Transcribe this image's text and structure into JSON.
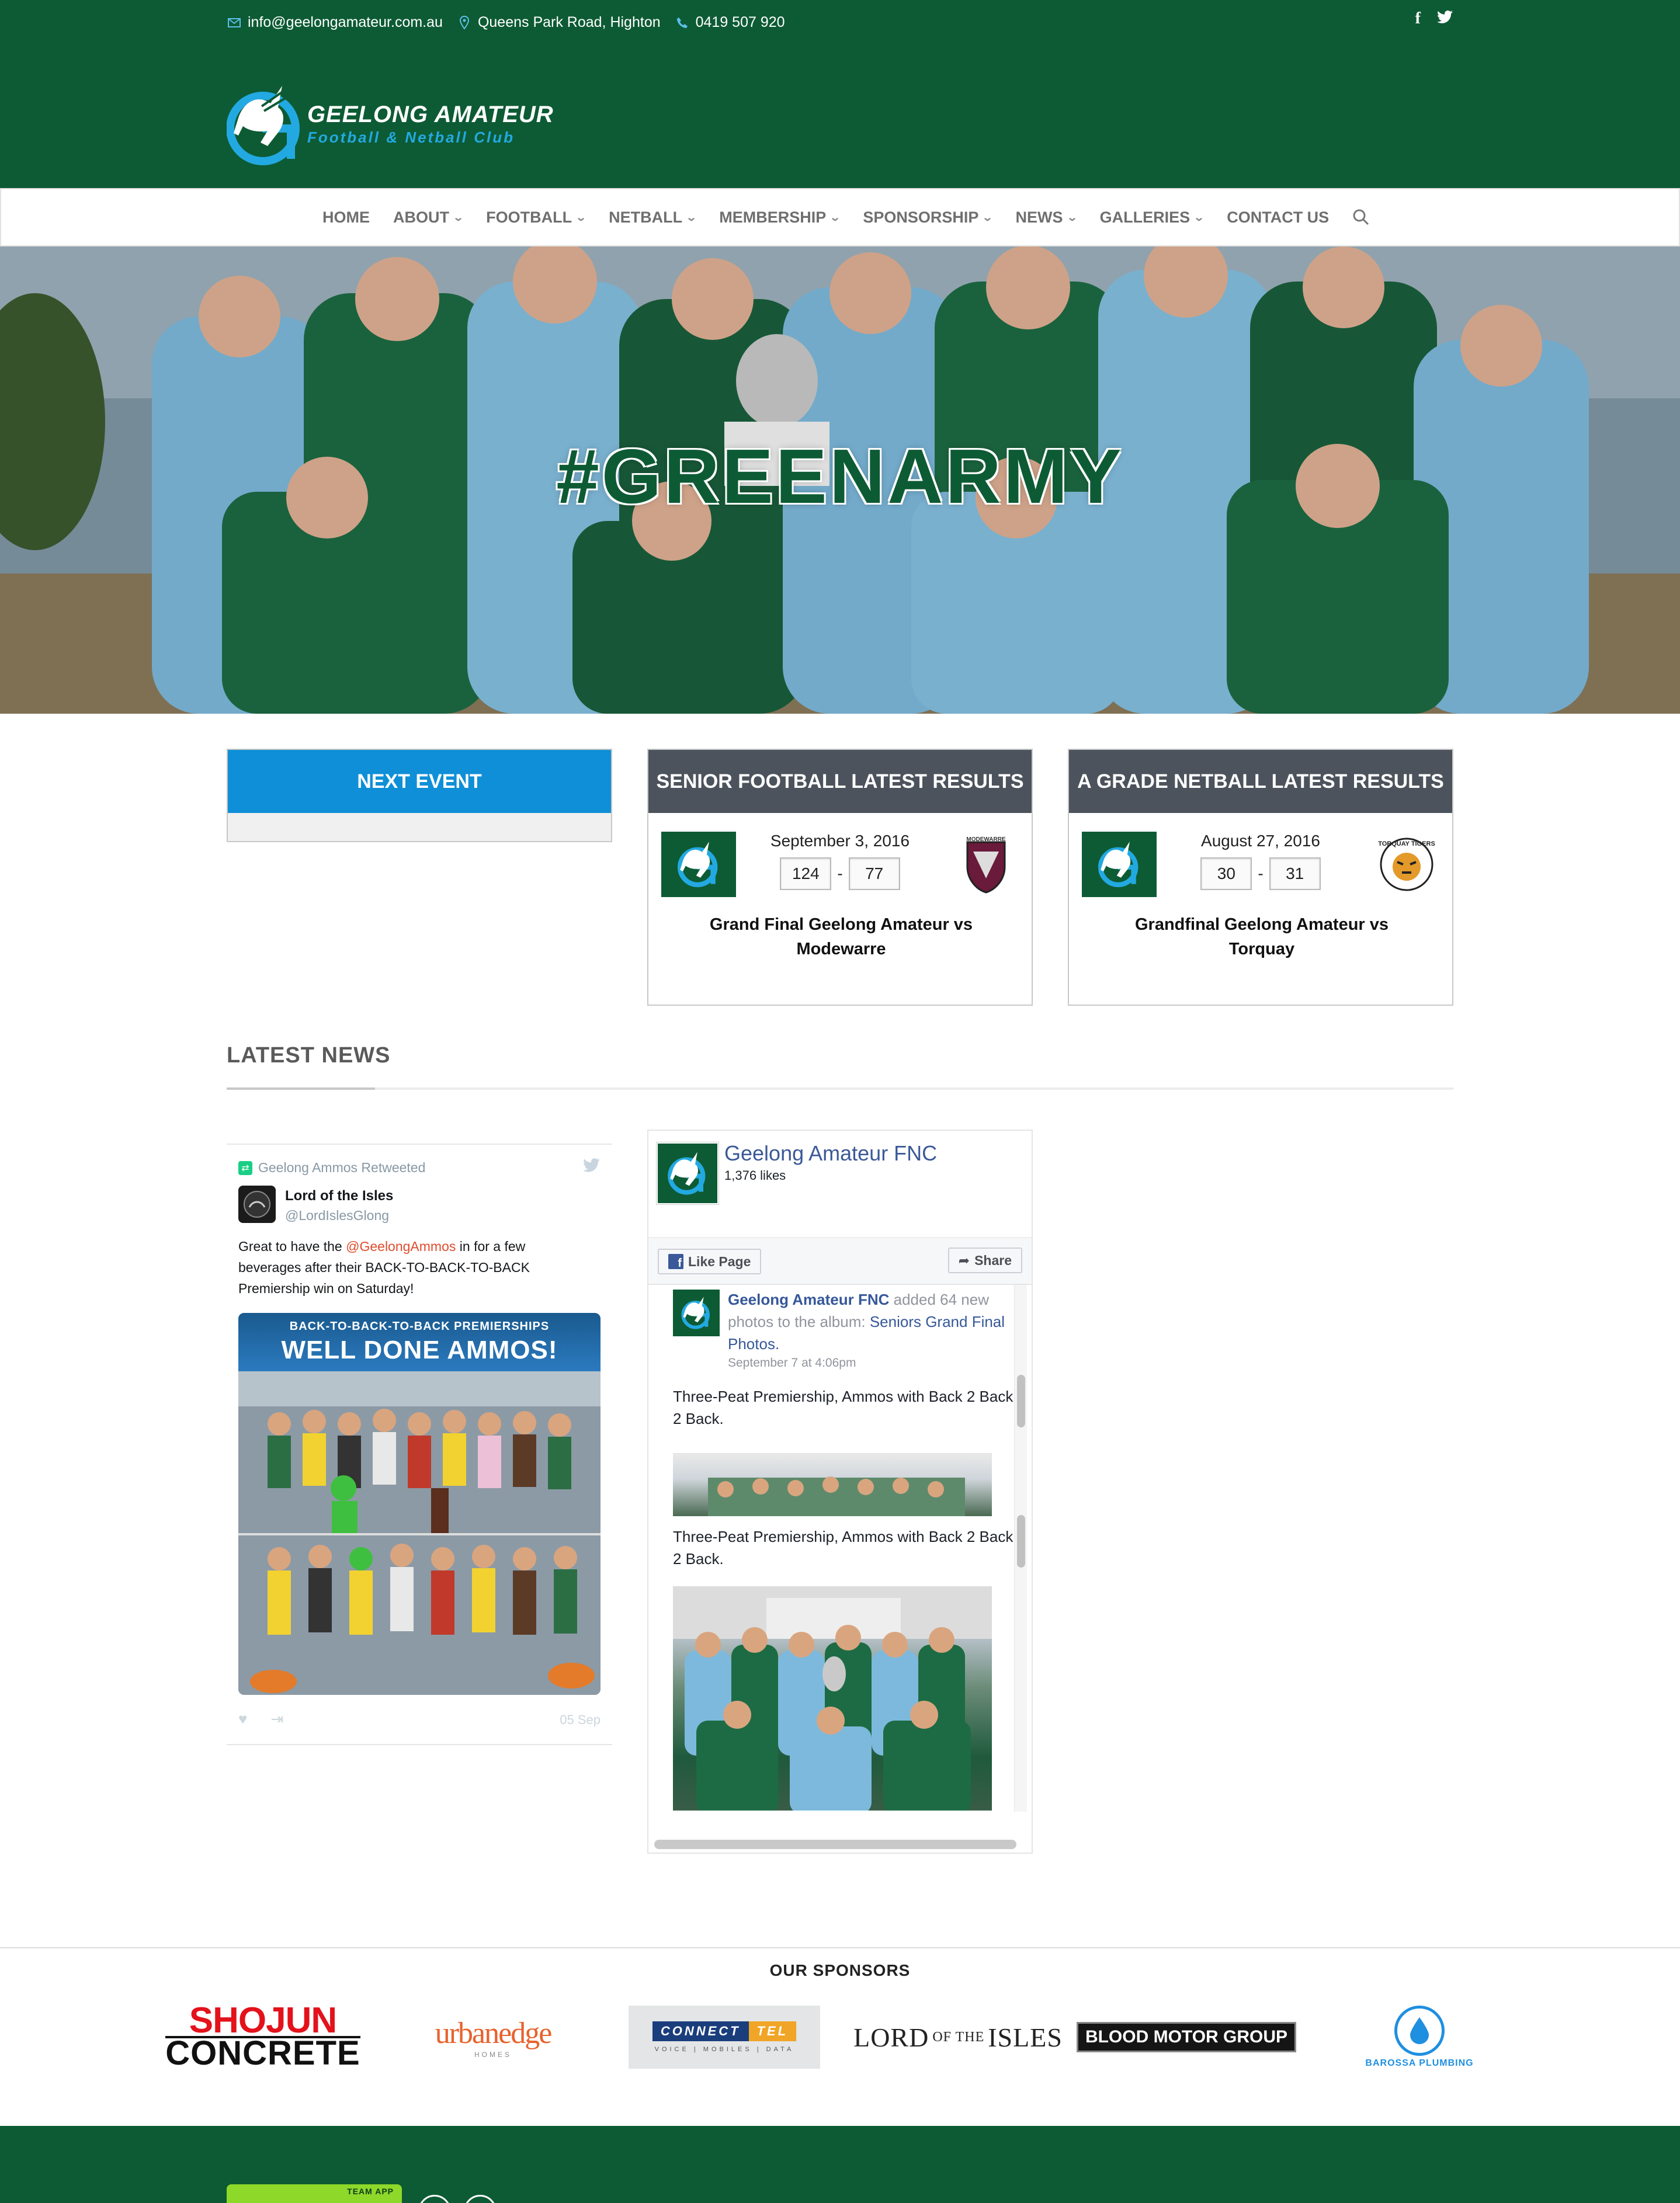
{
  "topbar": {
    "email": "info@geelongamateur.com.au",
    "address": "Queens Park Road, Highton",
    "phone": "0419 507 920",
    "social": {
      "facebook": "f",
      "twitter": "twitter-icon"
    }
  },
  "header": {
    "club_name": "GEELONG AMATEUR",
    "club_sub": "Football & Netball Club",
    "brand_color": "#0d5b34",
    "accent_color": "#23a9e1"
  },
  "nav": {
    "items": [
      {
        "label": "HOME",
        "dropdown": false
      },
      {
        "label": "ABOUT",
        "dropdown": true
      },
      {
        "label": "FOOTBALL",
        "dropdown": true
      },
      {
        "label": "NETBALL",
        "dropdown": true
      },
      {
        "label": "MEMBERSHIP",
        "dropdown": true
      },
      {
        "label": "SPONSORSHIP",
        "dropdown": true
      },
      {
        "label": "NEWS",
        "dropdown": true
      },
      {
        "label": "GALLERIES",
        "dropdown": true
      },
      {
        "label": "CONTACT US",
        "dropdown": false
      }
    ]
  },
  "hero": {
    "title": "#GREENARMY"
  },
  "cards": {
    "next_event": {
      "title": "NEXT EVENT"
    },
    "senior": {
      "title": "SENIOR FOOTBALL LATEST RESULTS",
      "date": "September 3, 2016",
      "home_score": "124",
      "away_score": "77",
      "separator": "-",
      "match": "Grand Final Geelong Amateur vs Modewarre",
      "away_logo_text": "MODEWARRE"
    },
    "netball": {
      "title": "A GRADE NETBALL LATEST RESULTS",
      "date": "August 27, 2016",
      "home_score": "30",
      "away_score": "31",
      "separator": "-",
      "match": "Grandfinal Geelong Amateur vs Torquay",
      "away_logo_text": "TORQUAY TIGERS"
    }
  },
  "news": {
    "title": "LATEST NEWS",
    "tweet": {
      "retweeted_by": "Geelong Ammos Retweeted",
      "user": "Lord of the Isles",
      "handle": "@LordIslesGlong",
      "text_before": "Great to have the ",
      "mention": "@GeelongAmmos",
      "text_after": " in for a few beverages after their BACK-TO-BACK-TO-BACK Premiership win on Saturday!",
      "image_banner_line1": "BACK-TO-BACK-TO-BACK PREMIERSHIPS",
      "image_banner_line2": "WELL DONE AMMOS!",
      "date": "05 Sep"
    },
    "facebook": {
      "page_name": "Geelong Amateur FNC",
      "likes": "1,376 likes",
      "like_button": "Like Page",
      "share_button": "Share",
      "post_author": "Geelong Amateur FNC",
      "post_action": " added 64 new photos to the album: ",
      "post_album": "Seniors Grand Final Photos.",
      "post_time": "September 7 at 4:06pm",
      "post_text_1": "Three-Peat Premiership, Ammos with Back 2 Back 2 Back.",
      "post_text_2": "Three-Peat Premiership, Ammos with Back 2 Back 2 Back."
    }
  },
  "sponsors": {
    "title": "OUR SPONSORS",
    "shojun_1": "SHOJUN",
    "shojun_2": "CONCRETE",
    "urbanedge": "urbanedge",
    "urbanedge_sub": "HOMES",
    "connect_1": "CONNECT",
    "connect_2": "TEL",
    "connect_tag": "VOICE | MOBILES | DATA",
    "lord_1": "LORD",
    "lord_2": "OF THE",
    "lord_3": "ISLES",
    "blood": "BLOOD MOTOR GROUP",
    "barossa": "BAROSSA PLUMBING"
  },
  "footer": {
    "teamapp": "TEAM APP"
  }
}
